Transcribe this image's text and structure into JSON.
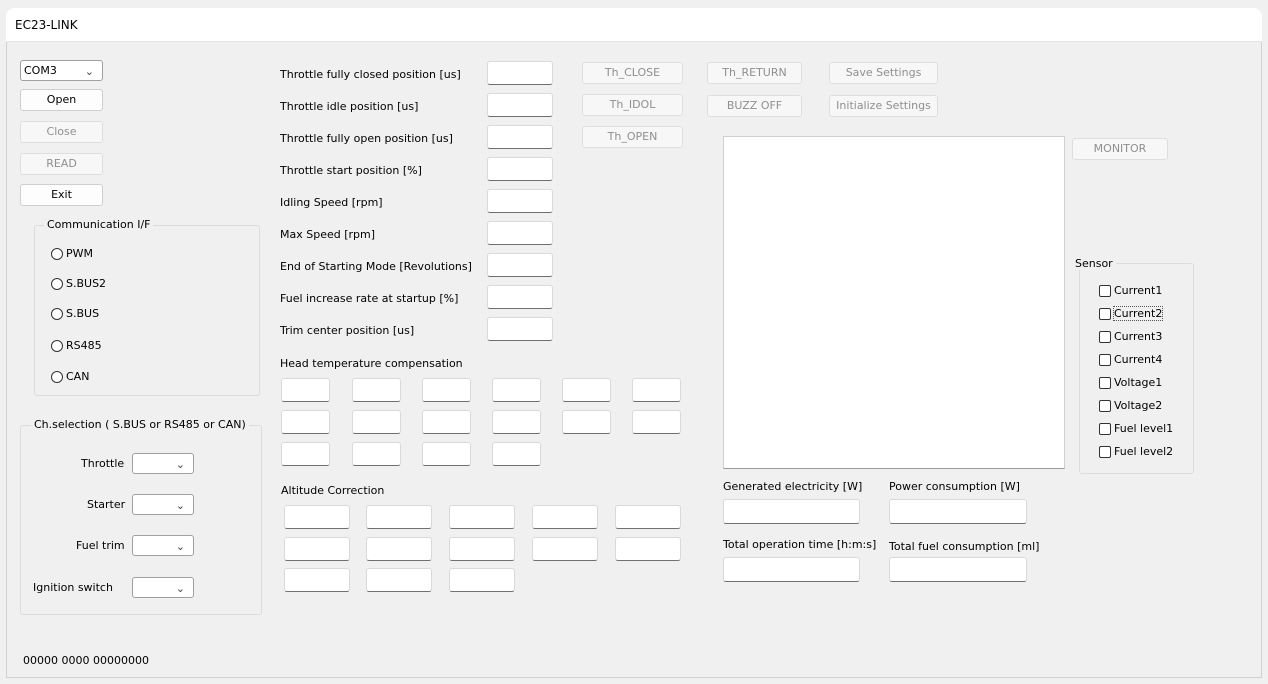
{
  "window": {
    "title": "EC23-LINK"
  },
  "left": {
    "port_value": "COM3",
    "open_label": "Open",
    "close_label": "Close",
    "read_label": "READ",
    "exit_label": "Exit"
  },
  "comm": {
    "title": "Communication I/F",
    "options": [
      "PWM",
      "S.BUS2",
      "S.BUS",
      "RS485",
      "CAN"
    ]
  },
  "chsel": {
    "title": "Ch.selection ( S.BUS or RS485 or CAN)",
    "rows": [
      "Throttle",
      "Starter",
      "Fuel trim",
      "Ignition switch"
    ]
  },
  "params": [
    "Throttle fully closed position [us]",
    "Throttle idle position [us]",
    "Throttle fully open position [us]",
    "Throttle start position [%]",
    "Idling Speed [rpm]",
    "Max Speed [rpm]",
    "End of Starting Mode [Revolutions]",
    "Fuel increase rate at startup [%]",
    "Trim center position [us]"
  ],
  "buttons": {
    "th_close": "Th_CLOSE",
    "th_idol": "Th_IDOL",
    "th_open": "Th_OPEN",
    "th_return": "Th_RETURN",
    "buzz_off": "BUZZ OFF",
    "save_settings": "Save Settings",
    "init_settings": "Initialize Settings",
    "monitor": "MONITOR"
  },
  "head_temp": {
    "title": "Head temperature compensation"
  },
  "altitude": {
    "title": "Altitude Correction"
  },
  "readouts": {
    "generated": "Generated electricity [W]",
    "power": "Power consumption [W]",
    "total_time": "Total operation time [h:m:s]",
    "total_fuel": "Total fuel consumption [ml]"
  },
  "sensor": {
    "title": "Sensor",
    "items": [
      "Current1",
      "Current2",
      "Current3",
      "Current4",
      "Voltage1",
      "Voltage2",
      "Fuel level1",
      "Fuel level2"
    ]
  },
  "status": {
    "text": "00000 0000 00000000"
  }
}
